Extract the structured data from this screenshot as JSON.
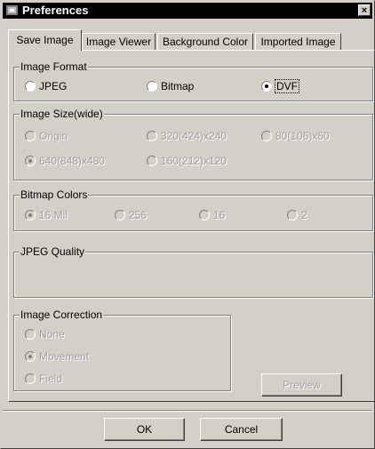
{
  "window": {
    "title": "Preferences",
    "close_glyph": "×"
  },
  "tabs": [
    {
      "label": "Save Image",
      "active": true
    },
    {
      "label": "Image Viewer",
      "active": false
    },
    {
      "label": "Background Color",
      "active": false
    },
    {
      "label": "Imported Image",
      "active": false
    }
  ],
  "image_format": {
    "title": "Image Format",
    "options": [
      "JPEG",
      "Bitmap",
      "DVF"
    ],
    "selected": "DVF"
  },
  "image_size": {
    "title": "Image Size(wide)",
    "options": [
      "Origin",
      "320(424)x240",
      "80(106)x60",
      "640(848)x480",
      "160(212)x120"
    ],
    "selected": "640(848)x480",
    "enabled": false
  },
  "bitmap_colors": {
    "title": "Bitmap Colors",
    "options": [
      "16 Mil",
      "256",
      "16",
      "2"
    ],
    "selected": "16 Mil",
    "enabled": false
  },
  "jpeg_quality": {
    "title": "JPEG Quality"
  },
  "image_correction": {
    "title": "Image Correction",
    "options": [
      "None",
      "Movement",
      "Field"
    ],
    "selected": "Movement",
    "enabled": false
  },
  "preview_button": {
    "label": "Preview",
    "enabled": false
  },
  "footer": {
    "ok_label": "OK",
    "cancel_label": "Cancel"
  },
  "colors": {
    "titlebar": "#000000",
    "face": "#d4d0c8",
    "disabled_text": "#a0a0a0"
  },
  "icons": {
    "app": "app-window-icon",
    "close": "close-icon"
  }
}
